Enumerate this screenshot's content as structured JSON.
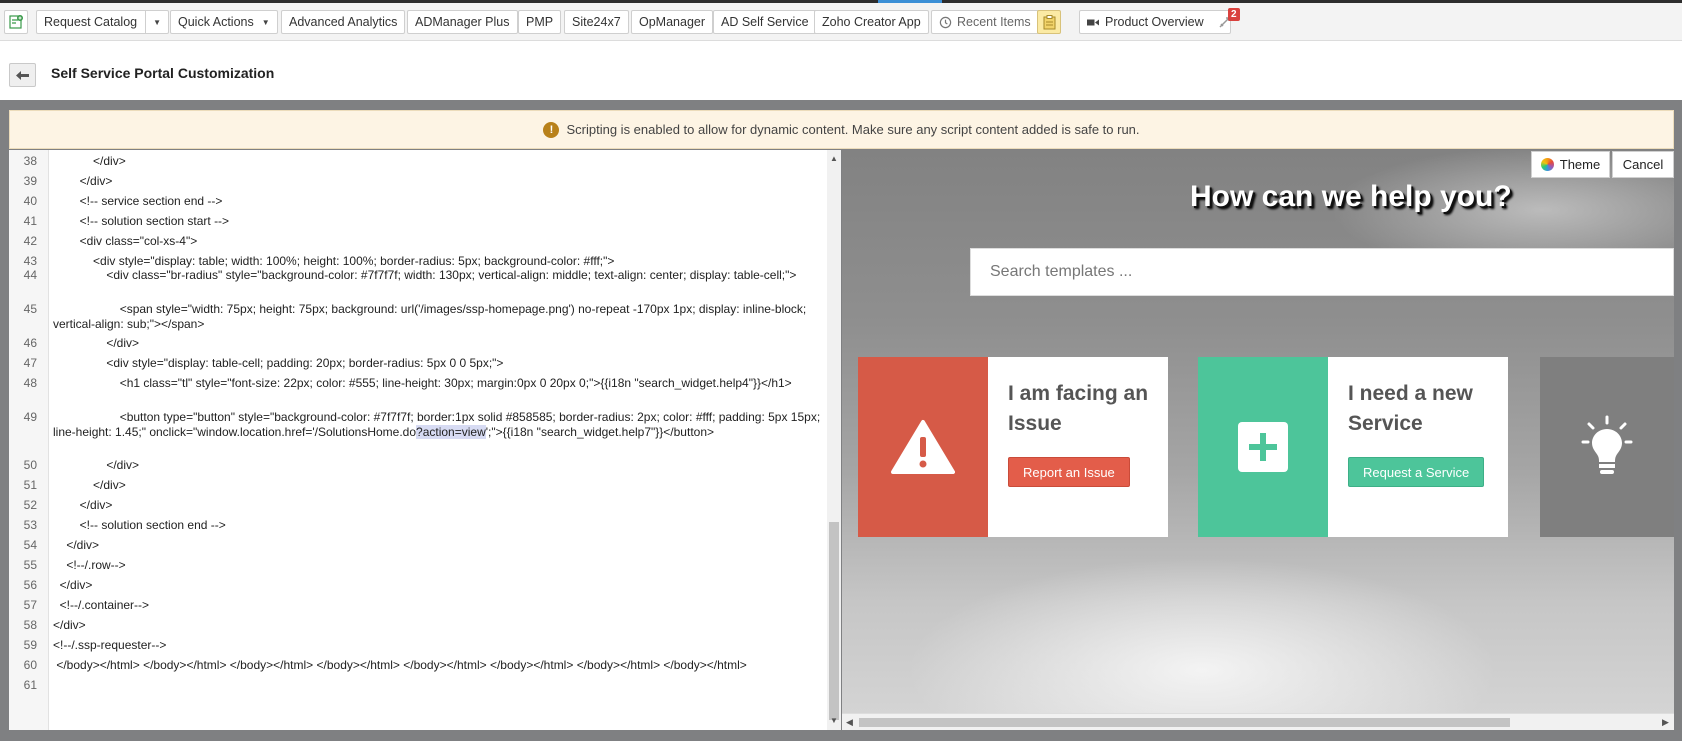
{
  "toolbar": {
    "request_catalog": "Request Catalog",
    "quick_actions": "Quick Actions",
    "advanced_analytics": "Advanced Analytics",
    "admanager_plus": "ADManager Plus",
    "pmp": "PMP",
    "site24x7": "Site24x7",
    "opmanager": "OpManager",
    "ad_self_service": "AD Self Service",
    "zoho_creator_app": "Zoho Creator App",
    "recent_items": "Recent Items",
    "product_overview": "Product Overview",
    "notification_count": "2"
  },
  "page": {
    "title": "Self Service Portal Customization"
  },
  "notice": {
    "text": "Scripting is enabled to allow for dynamic content. Make sure any script content added is safe to run."
  },
  "editor": {
    "lines": [
      {
        "num": "38",
        "text": "            </div>"
      },
      {
        "num": "39",
        "text": "        </div>"
      },
      {
        "num": "40",
        "text": "        <!-- service section end -->"
      },
      {
        "num": "41",
        "text": "        <!-- solution section start -->"
      },
      {
        "num": "42",
        "text": "        <div class=\"col-xs-4\">"
      },
      {
        "num": "43",
        "text": "            <div style=\"display: table; width: 100%; height: 100%; border-radius: 5px; background-color: #fff;\">"
      },
      {
        "num": "44",
        "text": "                <div class=\"br-radius\" style=\"background-color: #7f7f7f; width: 130px; vertical-align: middle; text-align: center; display: table-cell;\">"
      },
      {
        "num": "45",
        "text": "                    <span style=\"width: 75px; height: 75px; background: url('/images/ssp-homepage.png') no-repeat -170px 1px; display: inline-block; vertical-align: sub;\"></span>"
      },
      {
        "num": "46",
        "text": "                </div>"
      },
      {
        "num": "47",
        "text": "                <div style=\"display: table-cell; padding: 20px; border-radius: 5px 0 0 5px;\">"
      },
      {
        "num": "48",
        "text": "                    <h1 class=\"tl\" style=\"font-size: 22px; color: #555; line-height: 30px; margin:0px 0 20px 0;\">{{i18n \"search_widget.help4\"}}</h1>"
      },
      {
        "num": "49",
        "pre": "                    <button type=\"button\" style=\"background-color: #7f7f7f; border:1px solid #858585; border-radius: 2px; color: #fff; padding: 5px 15px; line-height: 1.45;\" onclick=\"window.location.href='/SolutionsHome.do",
        "highlight": "?action=view",
        "post": "';\">{{i18n \"search_widget.help7\"}}</button>"
      },
      {
        "num": "50",
        "text": "                </div>"
      },
      {
        "num": "51",
        "text": "            </div>"
      },
      {
        "num": "52",
        "text": "        </div>"
      },
      {
        "num": "53",
        "text": "        <!-- solution section end -->"
      },
      {
        "num": "54",
        "text": "    </div>"
      },
      {
        "num": "55",
        "text": "    <!--/.row-->"
      },
      {
        "num": "56",
        "text": "  </div>"
      },
      {
        "num": "57",
        "text": "  <!--/.container-->"
      },
      {
        "num": "58",
        "text": "</div>"
      },
      {
        "num": "59",
        "text": "<!--/.ssp-requester-->"
      },
      {
        "num": "60",
        "text": " </body></html> </body></html> </body></html> </body></html> </body></html> </body></html> </body></html> </body></html>"
      },
      {
        "num": "61",
        "text": ""
      }
    ]
  },
  "preview": {
    "theme_label": "Theme",
    "cancel_label": "Cancel",
    "heading": "How can we help you?",
    "search_placeholder": "Search templates ...",
    "cards": [
      {
        "title": "I am facing an Issue",
        "button": "Report an Issue",
        "color": "#d65a47",
        "button_color": "#e35d4a",
        "icon": "warning-icon"
      },
      {
        "title": "I need a new Service",
        "button": "Request a Service",
        "color": "#4dc59a",
        "button_color": "#4dc59a",
        "icon": "plus-icon"
      },
      {
        "title": "",
        "button": "",
        "color": "#7f7f7f",
        "icon": "lightbulb-icon"
      }
    ]
  },
  "colors": {
    "accent_blue": "#3b8fd6",
    "notice_bg": "#fdf4e4",
    "warn": "#b8811a",
    "badge": "#d9413d"
  }
}
